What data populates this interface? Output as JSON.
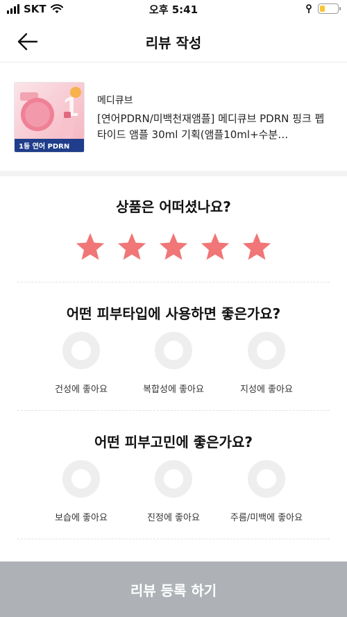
{
  "status_bar": {
    "carrier": "SKT",
    "time": "오후 5:41",
    "battery_level": 0.3
  },
  "header": {
    "title": "리뷰 작성"
  },
  "product": {
    "brand": "메디큐브",
    "name": "[연어PDRN/미백천재앰플] 메디큐브 PDRN 핑크 펩타이드 앰플 30ml 기획(앰플10ml+수분…",
    "thumb_badge": "1등 연어 PDRN"
  },
  "rating": {
    "question": "상품은 어떠셨나요?",
    "value": 5,
    "max": 5,
    "star_color": "#f07677"
  },
  "skin_type": {
    "question": "어떤 피부타입에 사용하면 좋은가요?",
    "options": [
      "건성에 좋아요",
      "복합성에 좋아요",
      "지성에 좋아요"
    ]
  },
  "skin_concern": {
    "question": "어떤 피부고민에 좋은가요?",
    "options": [
      "보습에 좋아요",
      "진정에 좋아요",
      "주름/미백에 좋아요"
    ]
  },
  "submit": {
    "label": "리뷰 등록 하기"
  }
}
